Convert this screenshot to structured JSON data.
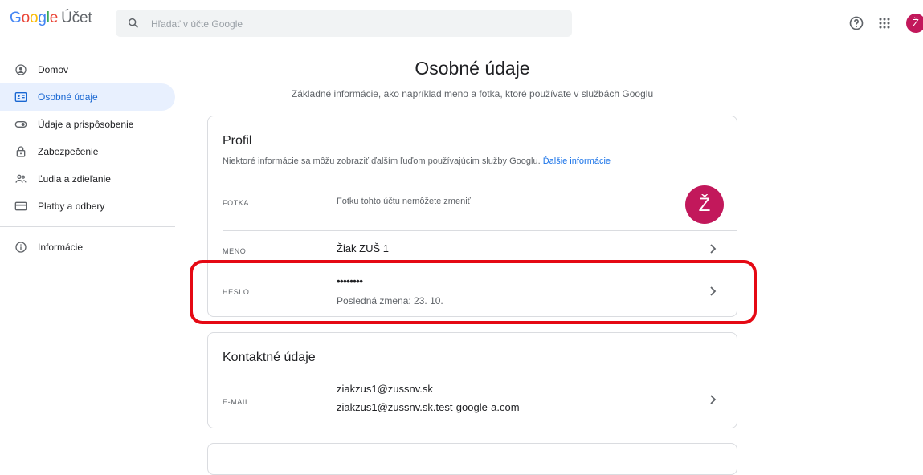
{
  "header": {
    "logo_google": "Google",
    "logo_product": "Účet",
    "search_placeholder": "Hľadať v účte Google",
    "avatar_initial": "Ž"
  },
  "sidebar": {
    "items": [
      {
        "label": "Domov",
        "icon": "home-icon"
      },
      {
        "label": "Osobné údaje",
        "icon": "id-card-icon",
        "active": true
      },
      {
        "label": "Údaje a prispôsobenie",
        "icon": "toggle-icon"
      },
      {
        "label": "Zabezpečenie",
        "icon": "lock-icon"
      },
      {
        "label": "Ľudia a zdieľanie",
        "icon": "people-icon"
      },
      {
        "label": "Platby a odbery",
        "icon": "card-icon"
      },
      {
        "label": "Informácie",
        "icon": "info-icon"
      }
    ]
  },
  "main": {
    "title": "Osobné údaje",
    "subtitle": "Základné informácie, ako napríklad meno a fotka, ktoré používate v službách Googlu",
    "profile": {
      "title": "Profil",
      "desc": "Niektoré informácie sa môžu zobraziť ďalším ľuďom používajúcim služby Googlu.",
      "desc_link": "Ďalšie informácie",
      "photo_label": "FOTKA",
      "photo_value": "Fotku tohto účtu nemôžete zmeniť",
      "photo_initial": "Ž",
      "name_label": "MENO",
      "name_value": "Žiak ZUŠ 1",
      "password_label": "HESLO",
      "password_value": "••••••••",
      "password_sub": "Posledná zmena: 23. 10."
    },
    "contact": {
      "title": "Kontaktné údaje",
      "email_label": "E-MAIL",
      "email_1": "ziakzus1@zussnv.sk",
      "email_2": "ziakzus1@zussnv.sk.test-google-a.com"
    }
  },
  "colors": {
    "accent": "#1a73e8",
    "active_bg": "#e8f0fe",
    "avatar": "#c2185b",
    "highlight": "#e50914"
  }
}
